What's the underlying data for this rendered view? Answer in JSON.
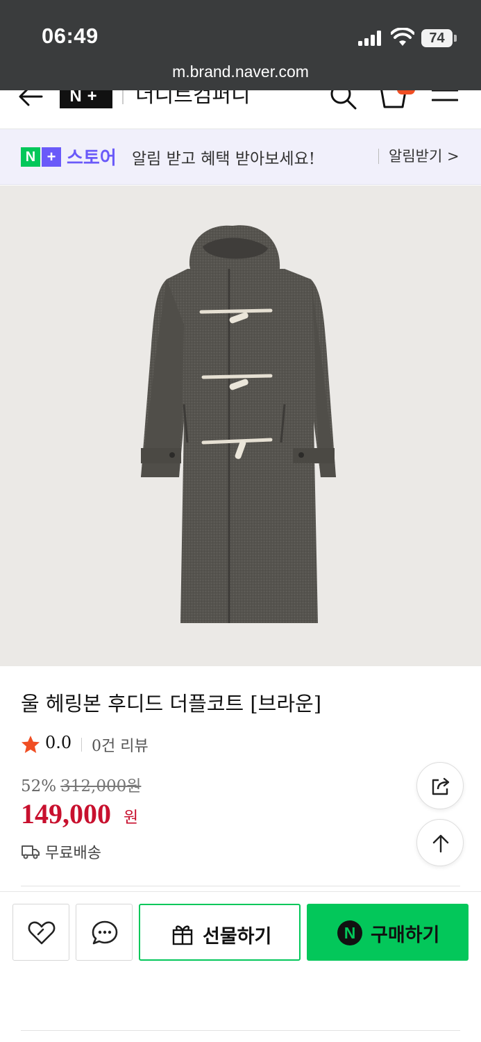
{
  "status_bar": {
    "time": "06:49",
    "battery": "74",
    "url": "m.brand.naver.com"
  },
  "header": {
    "logo_text": "N+",
    "brand_name": "더니트컴퍼니"
  },
  "store_banner": {
    "logo_n": "N",
    "logo_plus": "+",
    "store_label": "스토어",
    "message": "알림 받고 혜택 받아보세요!",
    "link_label": "알림받기 >"
  },
  "product": {
    "title": "울 헤링본 후디드 더플코트 [브라운]",
    "rating": "0.0",
    "review_count": "0건 리뷰",
    "discount": "52%",
    "original_price": "312,000원",
    "sale_price": "149,000",
    "sale_unit": "원",
    "shipping": "무료배송"
  },
  "actions": {
    "gift_label": "선물하기",
    "buy_icon_letter": "N",
    "buy_label": "구매하기"
  },
  "colors": {
    "accent_green": "#03c75a",
    "store_purple": "#6a5af9",
    "price_red": "#c8102e",
    "star_red": "#f04e23"
  },
  "icons": [
    "back-arrow-icon",
    "search-icon",
    "cart-icon",
    "menu-icon",
    "star-icon",
    "truck-icon",
    "share-icon",
    "arrow-up-icon",
    "heart-icon",
    "chat-icon",
    "gift-icon",
    "npay-icon"
  ]
}
